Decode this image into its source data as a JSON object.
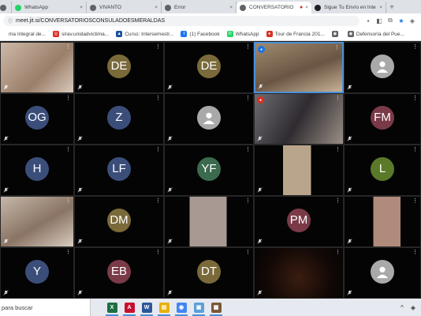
{
  "browser": {
    "tabs": [
      {
        "title": "",
        "favicon_color": "#5f6368",
        "active": false
      },
      {
        "title": "WhatsApp",
        "favicon_color": "#25d366",
        "active": false
      },
      {
        "title": "VIVANTO",
        "favicon_color": "#5f6368",
        "active": false
      },
      {
        "title": "Error",
        "favicon_color": "#5f6368",
        "active": false
      },
      {
        "title": "CONVERSATORIO",
        "favicon_color": "#5f6368",
        "active": true,
        "recording": true
      },
      {
        "title": "Sigue Tu Envío en Inte",
        "favicon_color": "#202124",
        "active": false
      }
    ],
    "close_glyph": "×",
    "new_tab_glyph": "+",
    "url": "meet.jit.si/CONVERSATORIOSCONSULADOESMERALDAS",
    "lock_glyph": "ⓘ"
  },
  "bookmarks": [
    {
      "label": "ma Integral de...",
      "icon_color": "#ffffff",
      "icon_text": ""
    },
    {
      "label": "sirav.unidadvictima...",
      "icon_color": "#d93025",
      "icon_text": "◎"
    },
    {
      "label": "Curso: Intersemestr...",
      "icon_color": "#1a4fa0",
      "icon_text": "▲"
    },
    {
      "label": "(1) Facebook",
      "icon_color": "#1877f2",
      "icon_text": "f"
    },
    {
      "label": "WhatsApp",
      "icon_color": "#25d366",
      "icon_text": "✆"
    },
    {
      "label": "Tour de Francia 201...",
      "icon_color": "#d93025",
      "icon_text": "●"
    },
    {
      "label": "",
      "icon_color": "#5f6368",
      "icon_text": "◉"
    },
    {
      "label": "Defensoría del Pue...",
      "icon_color": "#5f6368",
      "icon_text": "◉"
    }
  ],
  "tiles": [
    {
      "kind": "video",
      "bg": "linear-gradient(135deg,#cdb9a8,#9a7f6a 60%,#d9c9bb)",
      "muted": false
    },
    {
      "kind": "initials",
      "initials": "DE",
      "color": "#7a6a3a",
      "muted": true
    },
    {
      "kind": "initials",
      "initials": "DE",
      "color": "#7a6a3a",
      "muted": true
    },
    {
      "kind": "video",
      "bg": "linear-gradient(160deg,#9e8a6e,#6a5544 55%,#c8b296)",
      "muted": true,
      "badge": "blue",
      "selected": true
    },
    {
      "kind": "generic",
      "muted": true
    },
    {
      "kind": "initials",
      "initials": "OG",
      "color": "#3b4e7a",
      "muted": true
    },
    {
      "kind": "initials",
      "initials": "Z",
      "color": "#3b4e7a",
      "muted": true
    },
    {
      "kind": "generic",
      "muted": true
    },
    {
      "kind": "video",
      "bg": "linear-gradient(120deg,#6d6c72,#2f2b30 50%,#9a8f86)",
      "muted": false,
      "badge": "red"
    },
    {
      "kind": "initials",
      "initials": "FM",
      "color": "#7a3a48",
      "muted": true
    },
    {
      "kind": "initials",
      "initials": "H",
      "color": "#3b4e7a",
      "muted": true
    },
    {
      "kind": "initials",
      "initials": "LF",
      "color": "#3b4e7a",
      "muted": true
    },
    {
      "kind": "initials",
      "initials": "YF",
      "color": "#3b6a4e",
      "muted": true
    },
    {
      "kind": "video",
      "bg": "linear-gradient(90deg,#040404 0 32%,#b9a48c 32% 64%,#040404 64%)",
      "muted": true
    },
    {
      "kind": "initials",
      "initials": "L",
      "color": "#5a7a2a",
      "muted": true
    },
    {
      "kind": "video",
      "bg": "linear-gradient(150deg,#c5b8aa,#8a7464 55%,#d8ccc0)",
      "muted": false
    },
    {
      "kind": "initials",
      "initials": "DM",
      "color": "#7a6a3a",
      "muted": true
    },
    {
      "kind": "video",
      "bg": "linear-gradient(90deg,#040404 0 28%,#a89a92 28% 70%,#040404 70%)",
      "muted": true
    },
    {
      "kind": "initials",
      "initials": "PM",
      "color": "#7a3a48",
      "muted": true
    },
    {
      "kind": "video",
      "bg": "linear-gradient(90deg,#040404 0 38%,#b08a7a 38% 74%,#040404 74%)",
      "muted": true
    },
    {
      "kind": "initials",
      "initials": "Y",
      "color": "#3b4e7a",
      "muted": true
    },
    {
      "kind": "initials",
      "initials": "EB",
      "color": "#7a3a48",
      "muted": true
    },
    {
      "kind": "initials",
      "initials": "DT",
      "color": "#7a6a3a",
      "muted": true
    },
    {
      "kind": "video",
      "bg": "radial-gradient(circle at 50% 60%,#3a1d10,#120806 60%,#040404)",
      "muted": false
    },
    {
      "kind": "generic",
      "muted": true
    }
  ],
  "taskbar": {
    "search_text": "para buscar",
    "apps": [
      {
        "name": "excel-icon",
        "letter": "X",
        "color": "#1d6f42",
        "active": true
      },
      {
        "name": "acrobat-icon",
        "letter": "A",
        "color": "#c8102e",
        "active": true
      },
      {
        "name": "word-icon",
        "letter": "W",
        "color": "#2b579a",
        "active": true
      },
      {
        "name": "explorer-icon",
        "letter": "▤",
        "color": "#e8b000",
        "active": true
      },
      {
        "name": "chrome-icon",
        "letter": "◉",
        "color": "#4285f4",
        "active": true
      },
      {
        "name": "photos-icon",
        "letter": "▣",
        "color": "#5aa0d8",
        "active": true
      },
      {
        "name": "app-icon",
        "letter": "▩",
        "color": "#7a5a3a",
        "active": true
      }
    ]
  }
}
